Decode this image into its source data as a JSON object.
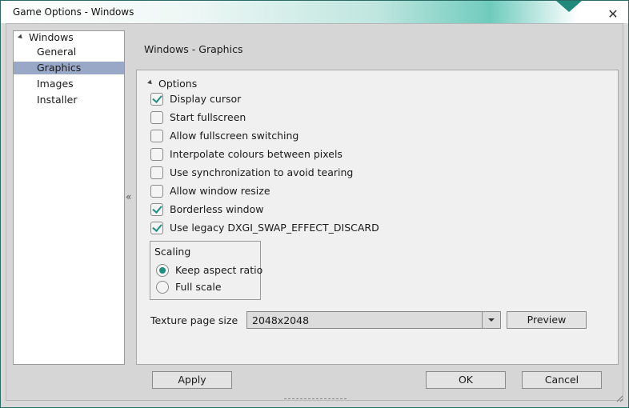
{
  "window": {
    "title": "Game Options - Windows"
  },
  "tree": {
    "root": "Windows",
    "items": [
      {
        "label": "General",
        "selected": false
      },
      {
        "label": "Graphics",
        "selected": true
      },
      {
        "label": "Images",
        "selected": false
      },
      {
        "label": "Installer",
        "selected": false
      }
    ]
  },
  "panel": {
    "title": "Windows - Graphics",
    "section": "Options",
    "options": [
      {
        "label": "Display cursor",
        "checked": true
      },
      {
        "label": "Start fullscreen",
        "checked": false
      },
      {
        "label": "Allow fullscreen switching",
        "checked": false
      },
      {
        "label": "Interpolate colours between pixels",
        "checked": false
      },
      {
        "label": "Use synchronization to avoid tearing",
        "checked": false
      },
      {
        "label": "Allow window resize",
        "checked": false
      },
      {
        "label": "Borderless window",
        "checked": true
      },
      {
        "label": "Use legacy DXGI_SWAP_EFFECT_DISCARD",
        "checked": true
      }
    ],
    "scaling": {
      "title": "Scaling",
      "options": [
        {
          "label": "Keep aspect ratio",
          "selected": true
        },
        {
          "label": "Full scale",
          "selected": false
        }
      ]
    },
    "texture": {
      "label": "Texture page size",
      "value": "2048x2048",
      "preview_label": "Preview"
    }
  },
  "buttons": {
    "apply": "Apply",
    "ok": "OK",
    "cancel": "Cancel"
  },
  "icons": {
    "close": "close-icon",
    "collapse": "double-chevron-left-icon"
  },
  "colors": {
    "accent": "#1e8f83",
    "selection": "#9aa8c8"
  }
}
